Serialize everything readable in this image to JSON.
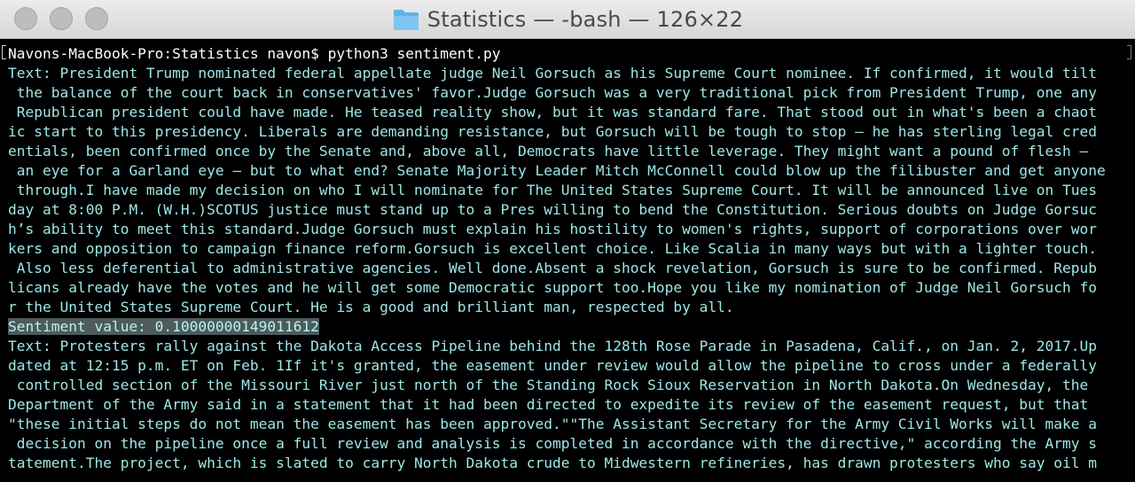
{
  "window": {
    "title": "Statistics — -bash — 126×22"
  },
  "terminal": {
    "prompt": "Navons-MacBook-Pro:Statistics navon$ python3 sentiment.py",
    "lines": [
      "Text: President Trump nominated federal appellate judge Neil Gorsuch as his Supreme Court nominee. If confirmed, it would tilt",
      " the balance of the court back in conservatives' favor.Judge Gorsuch was a very traditional pick from President Trump, one any",
      " Republican president could have made. He teased reality show, but it was standard fare. That stood out in what's been a chaot",
      "ic start to this presidency. Liberals are demanding resistance, but Gorsuch will be tough to stop – he has sterling legal cred",
      "entials, been confirmed once by the Senate and, above all, Democrats have little leverage. They might want a pound of flesh –",
      " an eye for a Garland eye – but to what end? Senate Majority Leader Mitch McConnell could blow up the filibuster and get anyone",
      " through.I have made my decision on who I will nominate for The United States Supreme Court. It will be announced live on Tues",
      "day at 8:00 P.M. (W.H.)SCOTUS justice must stand up to a Pres willing to bend the Constitution. Serious doubts on Judge Gorsuc",
      "h’s ability to meet this standard.Judge Gorsuch must explain his hostility to women's rights, support of corporations over wor",
      "kers and opposition to campaign finance reform.Gorsuch is excellent choice. Like Scalia in many ways but with a lighter touch.",
      " Also less deferential to administrative agencies. Well done.Absent a shock revelation, Gorsuch is sure to be confirmed. Repub",
      "licans already have the votes and he will get some Democratic support too.Hope you like my nomination of Judge Neil Gorsuch fo",
      "r the United States Supreme Court. He is a good and brilliant man, respected by all.",
      "Sentiment value: 0.10000000149011612",
      "Text: Protesters rally against the Dakota Access Pipeline behind the 128th Rose Parade in Pasadena, Calif., on Jan. 2, 2017.Up",
      "dated at 12:15 p.m. ET on Feb. 1If it's granted, the easement under review would allow the pipeline to cross under a federally",
      " controlled section of the Missouri River just north of the Standing Rock Sioux Reservation in North Dakota.On Wednesday, the",
      "Department of the Army said in a statement that it had been directed to expedite its review of the easement request, but that",
      "\"these initial steps do not mean the easement has been approved.\"\"The Assistant Secretary for the Army Civil Works will make a",
      " decision on the pipeline once a full review and analysis is completed in accordance with the directive,\" according the Army s",
      "tatement.The project, which is slated to carry North Dakota crude to Midwestern refineries, has drawn protesters who say oil m"
    ]
  }
}
